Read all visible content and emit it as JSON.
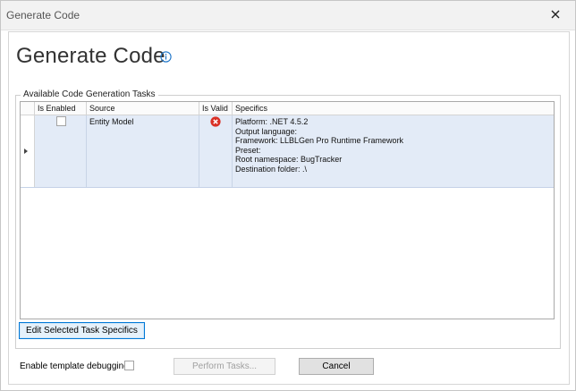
{
  "window": {
    "title": "Generate Code",
    "close_icon": "close-icon"
  },
  "heading": {
    "title": "Generate Code",
    "info_icon": "info-icon",
    "info_color": "#1a73c8"
  },
  "tasks": {
    "group_label": "Available Code Generation Tasks",
    "columns": [
      "Is Enabled",
      "Source",
      "Is Valid",
      "Specifics"
    ],
    "rows": [
      {
        "is_enabled": false,
        "source": "Entity Model",
        "is_valid": false,
        "valid_icon": "error-icon",
        "specifics": [
          "Platform: .NET 4.5.2",
          "Output language:",
          "Framework: LLBLGen Pro Runtime Framework",
          "Preset:",
          "Root namespace: BugTracker",
          "Destination folder: .\\"
        ]
      }
    ],
    "selected_row_color": "#e3ebf7",
    "error_color": "#d93025"
  },
  "buttons": {
    "edit_specifics": "Edit Selected Task Specifics",
    "perform": "Perform Tasks...",
    "cancel": "Cancel"
  },
  "options": {
    "template_debugging_label": "Enable template debugging",
    "template_debugging_checked": false
  }
}
